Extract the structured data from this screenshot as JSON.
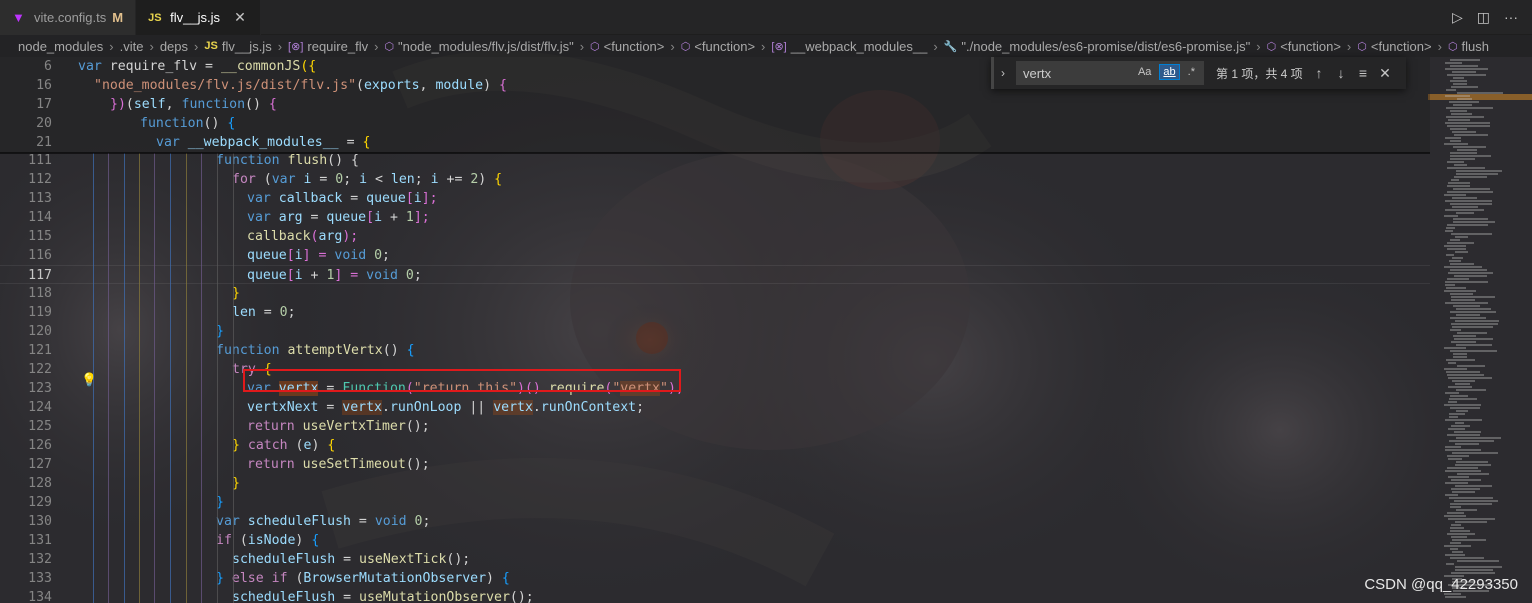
{
  "tabs": [
    {
      "icon": "vite-icon",
      "label": "vite.config.ts",
      "modified": "M",
      "active": false
    },
    {
      "icon": "js-icon",
      "icon_text": "JS",
      "label": "flv__js.js",
      "close": "✕",
      "active": true
    }
  ],
  "breadcrumbs": [
    {
      "label": "node_modules",
      "icon": ""
    },
    {
      "label": ".vite",
      "icon": ""
    },
    {
      "label": "deps",
      "icon": ""
    },
    {
      "label": "flv__js.js",
      "icon": "JS"
    },
    {
      "label": "require_flv",
      "icon": "[⊗]"
    },
    {
      "label": "\"node_modules/flv.js/dist/flv.js\"",
      "icon": "⬡"
    },
    {
      "label": "<function>",
      "icon": "⬡"
    },
    {
      "label": "<function>",
      "icon": "⬡"
    },
    {
      "label": "__webpack_modules__",
      "icon": "[⊗]"
    },
    {
      "label": "\"./node_modules/es6-promise/dist/es6-promise.js\"",
      "icon": "🔧"
    },
    {
      "label": "<function>",
      "icon": "⬡"
    },
    {
      "label": "<function>",
      "icon": "⬡"
    },
    {
      "label": "flush",
      "icon": "⬡"
    }
  ],
  "find": {
    "query": "vertx",
    "opt_case": "Aa",
    "opt_word": "ab",
    "opt_regex": ".*",
    "result": "第 1 项，共 4 项"
  },
  "lines": {
    "n6": "6",
    "n16": "16",
    "n17": "17",
    "n20": "20",
    "n21": "21",
    "n111": "111",
    "n112": "112",
    "n113": "113",
    "n114": "114",
    "n115": "115",
    "n116": "116",
    "n117": "117",
    "n118": "118",
    "n119": "119",
    "n120": "120",
    "n121": "121",
    "n122": "122",
    "n123": "123",
    "n124": "124",
    "n125": "125",
    "n126": "126",
    "n127": "127",
    "n128": "128",
    "n129": "129",
    "n130": "130",
    "n131": "131",
    "n132": "132",
    "n133": "133",
    "n134": "134"
  },
  "code": {
    "l6": [
      "var",
      " require_flv",
      " = ",
      "__commonJS",
      "({"
    ],
    "l16": [
      "\"node_modules/flv.js/dist/flv.js\"",
      "(",
      "exports",
      ", ",
      "module",
      ") ",
      "{"
    ],
    "l17": [
      "})",
      "(",
      "self",
      ", ",
      "function",
      "() ",
      "{"
    ],
    "l20": [
      "function",
      "() ",
      "{"
    ],
    "l21": [
      "var",
      " __webpack_modules__",
      " = ",
      "{"
    ],
    "l111": [
      "function",
      " flush",
      "() {"
    ],
    "l112": [
      "for",
      " (",
      "var",
      " i",
      " = ",
      "0",
      "; ",
      "i",
      " < ",
      "len",
      "; ",
      "i",
      " += ",
      "2",
      ") ",
      "{"
    ],
    "l113": [
      "var",
      " callback",
      " = ",
      "queue",
      "[",
      "i",
      "];"
    ],
    "l114": [
      "var",
      " arg",
      " = ",
      "queue",
      "[",
      "i",
      " + ",
      "1",
      "];"
    ],
    "l115": [
      "callback",
      "(",
      "arg",
      ");"
    ],
    "l116": [
      "queue",
      "[",
      "i",
      "] = ",
      "void",
      " ",
      "0",
      ";"
    ],
    "l117": [
      "queue",
      "[",
      "i",
      " + ",
      "1",
      "] = ",
      "void",
      " ",
      "0",
      ";"
    ],
    "l118": [
      "}"
    ],
    "l119": [
      "len",
      " = ",
      "0",
      ";"
    ],
    "l120": [
      "}"
    ],
    "l121": [
      "function",
      " attemptVertx",
      "() ",
      "{"
    ],
    "l122": [
      "try",
      " ",
      "{"
    ],
    "l123": [
      "var",
      " ",
      "vertx",
      " = ",
      "Function",
      "(",
      "\"return this\"",
      ")",
      "()",
      ".",
      "require",
      "(",
      "\"",
      "vertx",
      "\"",
      ");"
    ],
    "l124": [
      "vertxNext",
      " = ",
      "vertx",
      ".",
      "runOnLoop",
      " || ",
      "vertx",
      ".",
      "runOnContext",
      ";"
    ],
    "l125": [
      "return",
      " ",
      "useVertxTimer",
      "();"
    ],
    "l126": [
      "}",
      " ",
      "catch",
      " (",
      "e",
      ") ",
      "{"
    ],
    "l127": [
      "return",
      " ",
      "useSetTimeout",
      "();"
    ],
    "l128": [
      "}"
    ],
    "l129": [
      "}"
    ],
    "l130": [
      "var",
      " scheduleFlush",
      " = ",
      "void",
      " ",
      "0",
      ";"
    ],
    "l131": [
      "if",
      " (",
      "isNode",
      ") ",
      "{"
    ],
    "l132": [
      "scheduleFlush",
      " = ",
      "useNextTick",
      "();"
    ],
    "l133": [
      "}",
      " ",
      "else",
      " ",
      "if",
      " (",
      "BrowserMutationObserver",
      ") ",
      "{"
    ],
    "l134": [
      "scheduleFlush",
      " = ",
      "useMutationObserver",
      "();"
    ]
  },
  "watermark": "CSDN @qq_42293350",
  "colors": {
    "highlight_box": "#e0191b",
    "accent": "#007fd4"
  }
}
